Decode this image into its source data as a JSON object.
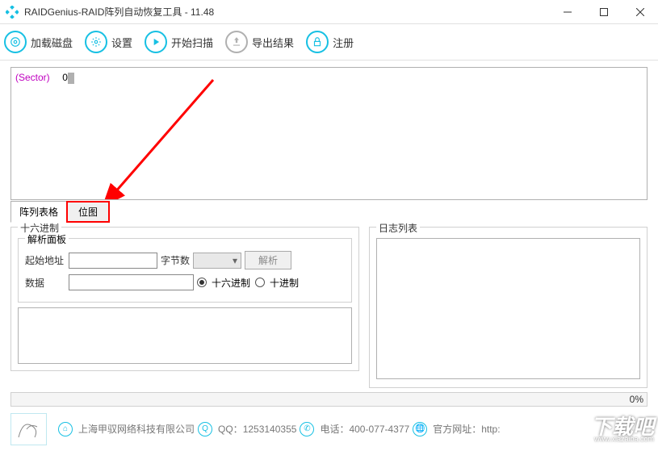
{
  "window": {
    "title": "RAIDGenius-RAID阵列自动恢复工具 - 11.48"
  },
  "toolbar": {
    "load_disk": "加载磁盘",
    "settings": "设置",
    "start_scan": "开始扫描",
    "export_result": "导出结果",
    "register": "注册"
  },
  "hex_view": {
    "sector_label": "(Sector)",
    "sector_value": "0"
  },
  "tabs": {
    "array_table": "阵列表格",
    "bitmap": "位图"
  },
  "hex_panel": {
    "title": "十六进制",
    "parse_panel": "解析面板",
    "start_address": "起始地址",
    "byte_count": "字节数",
    "parse_btn": "解析",
    "data": "数据",
    "radix_hex": "十六进制",
    "radix_dec": "十进制"
  },
  "log_panel": {
    "title": "日志列表"
  },
  "progress": {
    "percent": "0%"
  },
  "footer": {
    "company": "上海甲驭网络科技有限公司",
    "qq_label": "QQ：",
    "qq_value": "1253140355",
    "phone_label": "电话：",
    "phone_value": "400-077-4377",
    "website_label": "官方网址：",
    "website_value": "http:"
  },
  "watermark": {
    "main": "下载吧",
    "sub": "www.xiazaiba.com"
  }
}
